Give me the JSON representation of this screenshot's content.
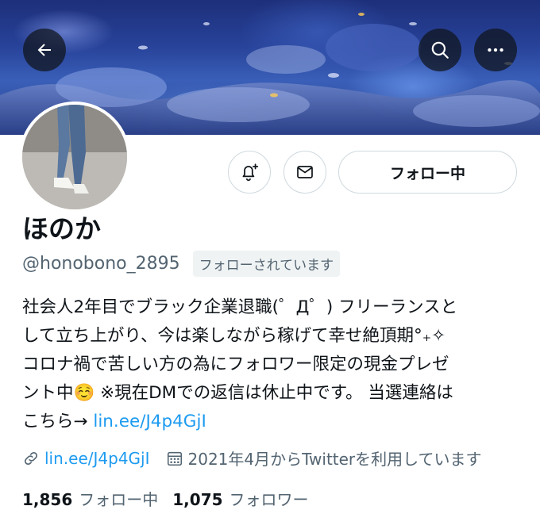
{
  "banner": {
    "description_icon": "coral-reef-banner"
  },
  "header": {
    "back_icon": "arrow-left-icon",
    "search_icon": "search-icon",
    "more_icon": "more-horizontal-icon"
  },
  "profile": {
    "name": "ほのか",
    "handle": "@honobono_2895",
    "follows_you": "フォローされています",
    "follow_button": "フォロー中",
    "bio_line1": "社会人2年目でブラック企業退職(゜Д゜) フリーランスと",
    "bio_line2": "して立ち上がり、今は楽しながら稼げて幸せ絶頂期°₊✧",
    "bio_line3": "コロナ禍で苦しい方の為にフォロワー限定の現金プレゼ",
    "bio_line4": "ント中☺️ ※現在DMでの返信は休止中です。 当選連絡は",
    "bio_line5_prefix": "こちら→ ",
    "bio_link": "lin.ee/J4p4GjI",
    "website": "lin.ee/J4p4GjI",
    "joined": "2021年4月からTwitterを利用しています"
  },
  "stats": {
    "following_count": "1,856",
    "following_label": "フォロー中",
    "followers_count": "1,075",
    "followers_label": "フォロワー"
  },
  "colors": {
    "accent": "#1d9bf0",
    "muted": "#536471",
    "text": "#0f1419"
  }
}
